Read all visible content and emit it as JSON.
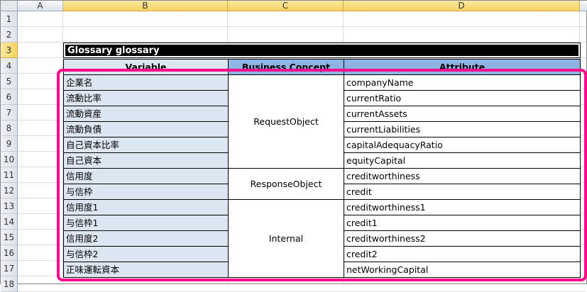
{
  "columns": [
    "A",
    "B",
    "C",
    "D"
  ],
  "rows": [
    "1",
    "2",
    "3",
    "4",
    "5",
    "6",
    "7",
    "8",
    "9",
    "10",
    "11",
    "12",
    "13",
    "14",
    "15",
    "16",
    "17",
    "18"
  ],
  "title": "Glossary glossary",
  "headers": {
    "variable": "Variable",
    "concept": "Business Concept",
    "attribute": "Attribute"
  },
  "entries": [
    {
      "variable": "企業名",
      "attribute": "companyName"
    },
    {
      "variable": "流動比率",
      "attribute": "currentRatio"
    },
    {
      "variable": "流動資産",
      "attribute": "currentAssets"
    },
    {
      "variable": "流動負債",
      "attribute": "currentLiabilities"
    },
    {
      "variable": "自己資本比率",
      "attribute": "capitalAdequacyRatio"
    },
    {
      "variable": "自己資本",
      "attribute": "equityCapital"
    },
    {
      "variable": "信用度",
      "attribute": "creditworthiness"
    },
    {
      "variable": "与信枠",
      "attribute": "credit"
    },
    {
      "variable": "信用度1",
      "attribute": "creditworthiness1"
    },
    {
      "variable": "与信枠1",
      "attribute": "credit1"
    },
    {
      "variable": "信用度2",
      "attribute": "creditworthiness2"
    },
    {
      "variable": "与信枠2",
      "attribute": "credit2"
    },
    {
      "variable": "正味運転資本",
      "attribute": "netWorkingCapital"
    }
  ],
  "concepts": [
    {
      "label": "RequestObject",
      "rows": 6
    },
    {
      "label": "ResponseObject",
      "rows": 2
    },
    {
      "label": "Internal",
      "rows": 5
    }
  ],
  "highlight_color": "#ff0a8c"
}
